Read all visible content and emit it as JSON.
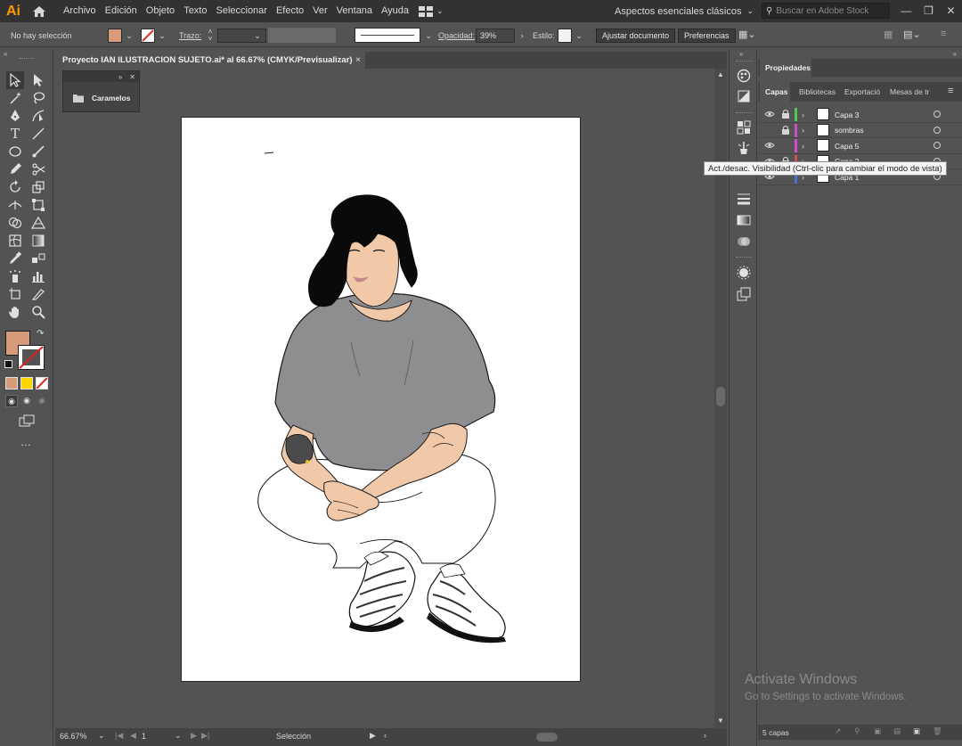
{
  "app": {
    "logo": "Ai"
  },
  "menu": [
    "Archivo",
    "Edición",
    "Objeto",
    "Texto",
    "Seleccionar",
    "Efecto",
    "Ver",
    "Ventana",
    "Ayuda"
  ],
  "workspace": {
    "label": "Aspectos esenciales clásicos"
  },
  "search": {
    "placeholder": "Buscar en Adobe Stock"
  },
  "control": {
    "selection": "No hay selección",
    "fill_color": "#c8907a",
    "stroke_label": "Trazo:",
    "opacity_label": "Opacidad:",
    "opacity_value": "39%",
    "style_label": "Estilo:",
    "fit_doc_button": "Ajustar documento",
    "prefs_button": "Preferencias"
  },
  "document": {
    "tab_title": "Proyecto IAN ILUSTRACION SUJETO.ai* al 66.67% (CMYK/Previsualizar)",
    "close": "×"
  },
  "floating_panel": {
    "label": "Caramelos"
  },
  "status": {
    "zoom": "66.67%",
    "artboard": "1",
    "tool": "Selección"
  },
  "right_panel": {
    "properties_tab": "Propiedades",
    "tabs": [
      "Capas",
      "Bibliotecas",
      "Exportació",
      "Mesas de tr"
    ],
    "layers": [
      {
        "name": "Capa 3",
        "visible": true,
        "locked": true,
        "color": "#4fc94f"
      },
      {
        "name": "sombras",
        "visible": false,
        "locked": true,
        "color": "#c94fc9"
      },
      {
        "name": "Capa 5",
        "visible": true,
        "locked": false,
        "color": "#d04fd0"
      },
      {
        "name": "Capa 2",
        "visible": true,
        "locked": true,
        "color": "#d04f4f"
      },
      {
        "name": "Capa 1",
        "visible": true,
        "locked": false,
        "color": "#4f6fd0"
      }
    ],
    "footer": "5 capas"
  },
  "tooltip": "Act./desac. Visibilidad (Ctrl-clic para cambiar el modo de vista)",
  "watermark": {
    "title": "Activate Windows",
    "subtitle": "Go to Settings to activate Windows."
  },
  "colors": {
    "skin": "#f2c9a8",
    "shirt": "#8e8e90",
    "hair": "#0a0a0a",
    "fill_swatch": "#d79a7a",
    "accent": "#ff9a00"
  }
}
